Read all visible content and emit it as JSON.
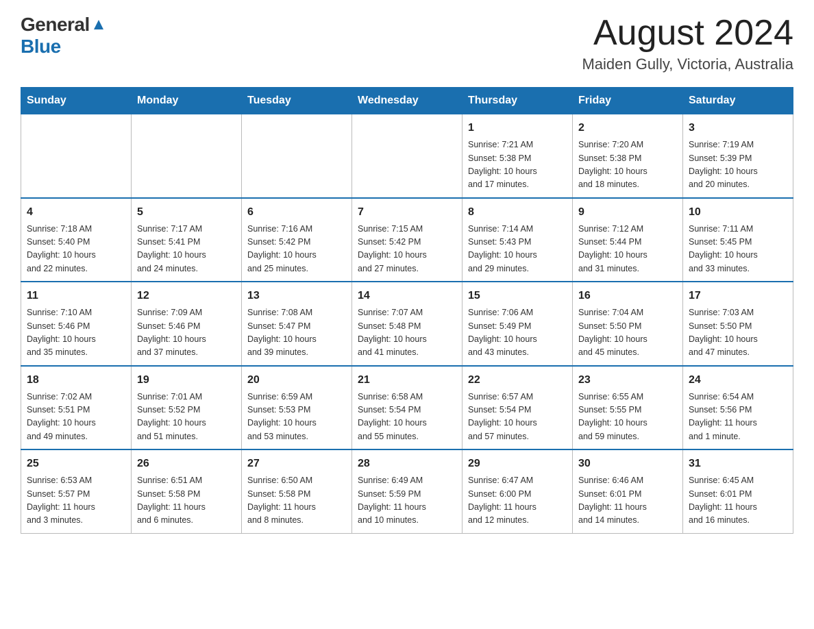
{
  "header": {
    "logo_general": "General",
    "logo_blue": "Blue",
    "month_year": "August 2024",
    "location": "Maiden Gully, Victoria, Australia"
  },
  "weekdays": [
    "Sunday",
    "Monday",
    "Tuesday",
    "Wednesday",
    "Thursday",
    "Friday",
    "Saturday"
  ],
  "weeks": [
    [
      {
        "day": "",
        "info": ""
      },
      {
        "day": "",
        "info": ""
      },
      {
        "day": "",
        "info": ""
      },
      {
        "day": "",
        "info": ""
      },
      {
        "day": "1",
        "info": "Sunrise: 7:21 AM\nSunset: 5:38 PM\nDaylight: 10 hours\nand 17 minutes."
      },
      {
        "day": "2",
        "info": "Sunrise: 7:20 AM\nSunset: 5:38 PM\nDaylight: 10 hours\nand 18 minutes."
      },
      {
        "day": "3",
        "info": "Sunrise: 7:19 AM\nSunset: 5:39 PM\nDaylight: 10 hours\nand 20 minutes."
      }
    ],
    [
      {
        "day": "4",
        "info": "Sunrise: 7:18 AM\nSunset: 5:40 PM\nDaylight: 10 hours\nand 22 minutes."
      },
      {
        "day": "5",
        "info": "Sunrise: 7:17 AM\nSunset: 5:41 PM\nDaylight: 10 hours\nand 24 minutes."
      },
      {
        "day": "6",
        "info": "Sunrise: 7:16 AM\nSunset: 5:42 PM\nDaylight: 10 hours\nand 25 minutes."
      },
      {
        "day": "7",
        "info": "Sunrise: 7:15 AM\nSunset: 5:42 PM\nDaylight: 10 hours\nand 27 minutes."
      },
      {
        "day": "8",
        "info": "Sunrise: 7:14 AM\nSunset: 5:43 PM\nDaylight: 10 hours\nand 29 minutes."
      },
      {
        "day": "9",
        "info": "Sunrise: 7:12 AM\nSunset: 5:44 PM\nDaylight: 10 hours\nand 31 minutes."
      },
      {
        "day": "10",
        "info": "Sunrise: 7:11 AM\nSunset: 5:45 PM\nDaylight: 10 hours\nand 33 minutes."
      }
    ],
    [
      {
        "day": "11",
        "info": "Sunrise: 7:10 AM\nSunset: 5:46 PM\nDaylight: 10 hours\nand 35 minutes."
      },
      {
        "day": "12",
        "info": "Sunrise: 7:09 AM\nSunset: 5:46 PM\nDaylight: 10 hours\nand 37 minutes."
      },
      {
        "day": "13",
        "info": "Sunrise: 7:08 AM\nSunset: 5:47 PM\nDaylight: 10 hours\nand 39 minutes."
      },
      {
        "day": "14",
        "info": "Sunrise: 7:07 AM\nSunset: 5:48 PM\nDaylight: 10 hours\nand 41 minutes."
      },
      {
        "day": "15",
        "info": "Sunrise: 7:06 AM\nSunset: 5:49 PM\nDaylight: 10 hours\nand 43 minutes."
      },
      {
        "day": "16",
        "info": "Sunrise: 7:04 AM\nSunset: 5:50 PM\nDaylight: 10 hours\nand 45 minutes."
      },
      {
        "day": "17",
        "info": "Sunrise: 7:03 AM\nSunset: 5:50 PM\nDaylight: 10 hours\nand 47 minutes."
      }
    ],
    [
      {
        "day": "18",
        "info": "Sunrise: 7:02 AM\nSunset: 5:51 PM\nDaylight: 10 hours\nand 49 minutes."
      },
      {
        "day": "19",
        "info": "Sunrise: 7:01 AM\nSunset: 5:52 PM\nDaylight: 10 hours\nand 51 minutes."
      },
      {
        "day": "20",
        "info": "Sunrise: 6:59 AM\nSunset: 5:53 PM\nDaylight: 10 hours\nand 53 minutes."
      },
      {
        "day": "21",
        "info": "Sunrise: 6:58 AM\nSunset: 5:54 PM\nDaylight: 10 hours\nand 55 minutes."
      },
      {
        "day": "22",
        "info": "Sunrise: 6:57 AM\nSunset: 5:54 PM\nDaylight: 10 hours\nand 57 minutes."
      },
      {
        "day": "23",
        "info": "Sunrise: 6:55 AM\nSunset: 5:55 PM\nDaylight: 10 hours\nand 59 minutes."
      },
      {
        "day": "24",
        "info": "Sunrise: 6:54 AM\nSunset: 5:56 PM\nDaylight: 11 hours\nand 1 minute."
      }
    ],
    [
      {
        "day": "25",
        "info": "Sunrise: 6:53 AM\nSunset: 5:57 PM\nDaylight: 11 hours\nand 3 minutes."
      },
      {
        "day": "26",
        "info": "Sunrise: 6:51 AM\nSunset: 5:58 PM\nDaylight: 11 hours\nand 6 minutes."
      },
      {
        "day": "27",
        "info": "Sunrise: 6:50 AM\nSunset: 5:58 PM\nDaylight: 11 hours\nand 8 minutes."
      },
      {
        "day": "28",
        "info": "Sunrise: 6:49 AM\nSunset: 5:59 PM\nDaylight: 11 hours\nand 10 minutes."
      },
      {
        "day": "29",
        "info": "Sunrise: 6:47 AM\nSunset: 6:00 PM\nDaylight: 11 hours\nand 12 minutes."
      },
      {
        "day": "30",
        "info": "Sunrise: 6:46 AM\nSunset: 6:01 PM\nDaylight: 11 hours\nand 14 minutes."
      },
      {
        "day": "31",
        "info": "Sunrise: 6:45 AM\nSunset: 6:01 PM\nDaylight: 11 hours\nand 16 minutes."
      }
    ]
  ]
}
